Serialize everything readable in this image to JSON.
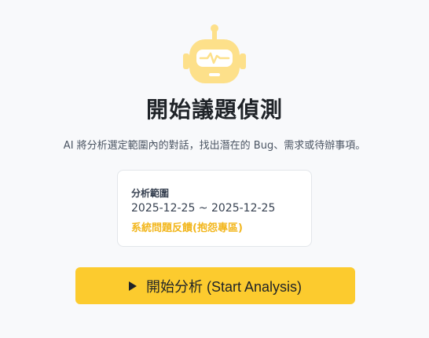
{
  "hero": {
    "icon": "robot-icon",
    "icon_color": "#fde08a",
    "title": "開始議題偵測",
    "description": "AI 將分析選定範圍內的對話，找出潛在的 Bug、需求或待辦事項。"
  },
  "scope_card": {
    "label": "分析範圍",
    "date_range": "2025-12-25 ~ 2025-12-25",
    "channel": "系統問題反饋(抱怨專區)",
    "channel_color": "#f2b61c"
  },
  "action": {
    "start_label": "開始分析 (Start Analysis)",
    "button_color": "#fccb2e",
    "icon": "play-icon"
  }
}
